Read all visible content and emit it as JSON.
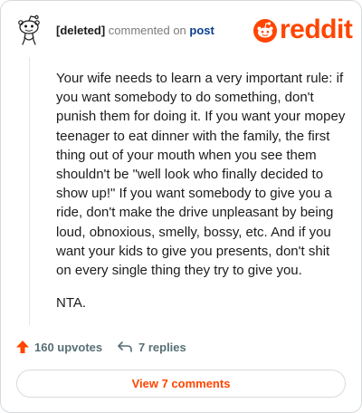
{
  "comment": {
    "author": "[deleted]",
    "action_text": "commented on",
    "post_link_text": "post",
    "body": [
      "Your wife needs to learn a very important rule: if you want somebody to do something, don't punish them for doing it. If you want your mopey teenager to eat dinner with the family, the first thing out of your mouth when you see them shouldn't be \"well look who finally decided to show up!\" If you want somebody to give you a ride, don't make the drive unpleasant by being loud, obnoxious, smelly, bossy, etc. And if you want your kids to give you presents, don't shit on every single thing they try to give you.",
      "NTA."
    ]
  },
  "logo": {
    "wordmark": "reddit"
  },
  "stats": {
    "upvotes": "160 upvotes",
    "replies": "7 replies"
  },
  "view_button": {
    "label": "View 7 comments"
  },
  "colors": {
    "brand": "#ff4500",
    "link": "#0a3d91",
    "muted": "#7c7c7c"
  },
  "icons": {
    "avatar": "snoo-avatar-icon",
    "upvote": "upvote-arrow-icon",
    "reply": "reply-arrow-icon",
    "logo": "reddit-snoo-icon"
  }
}
